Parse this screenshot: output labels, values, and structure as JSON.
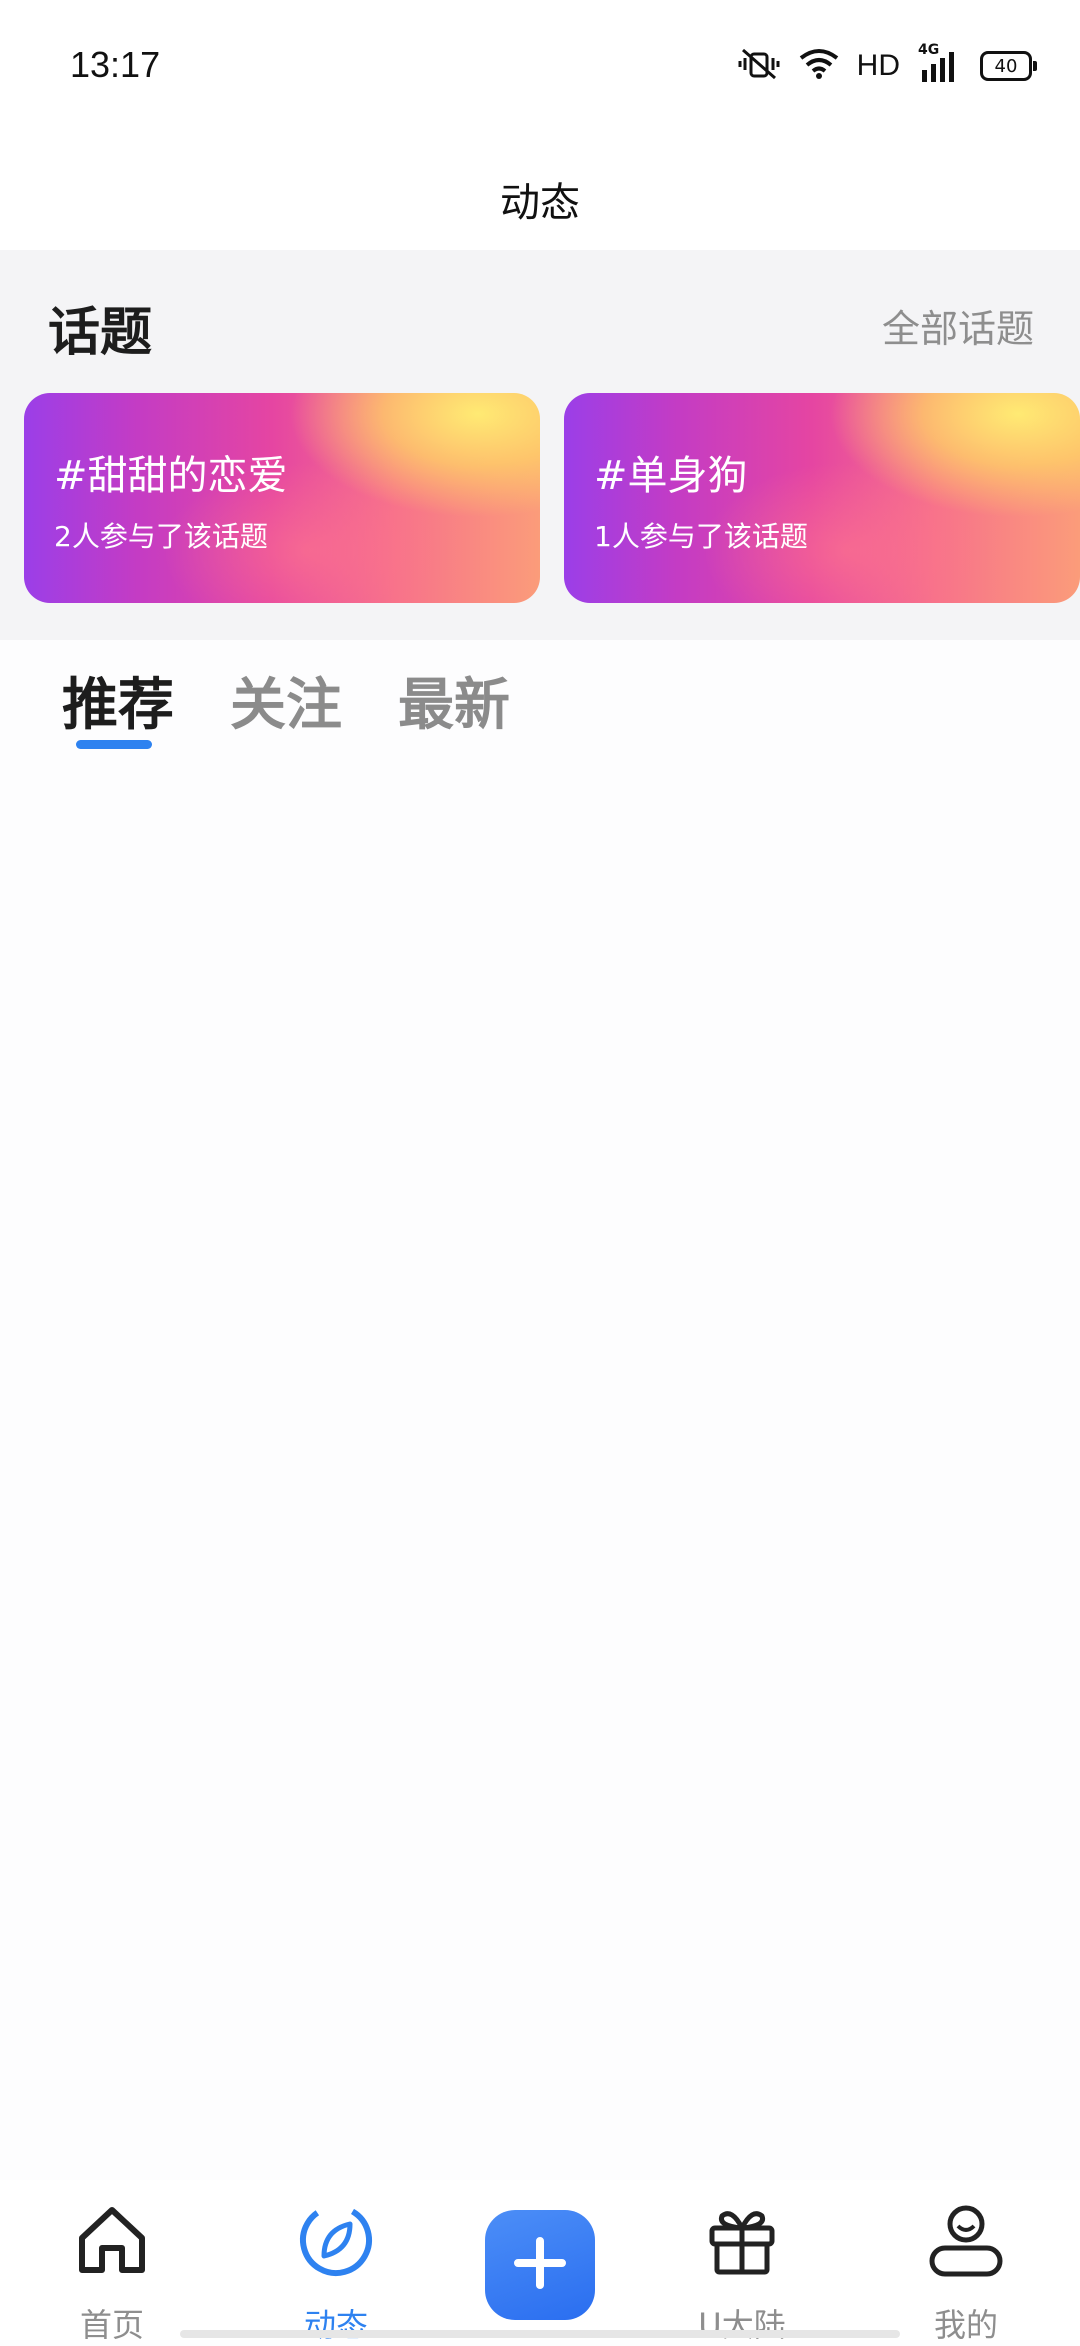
{
  "status_bar": {
    "time": "13:17",
    "network": "HD",
    "signal_label": "4G",
    "battery": "40"
  },
  "header": {
    "title": "动态"
  },
  "topics": {
    "heading": "话题",
    "all_link": "全部话题",
    "cards": [
      {
        "name": "#甜甜的恋爱",
        "participants": "2人参与了该话题"
      },
      {
        "name": "#单身狗",
        "participants": "1人参与了该话题"
      }
    ]
  },
  "tabs": [
    {
      "label": "推荐",
      "active": true
    },
    {
      "label": "关注",
      "active": false
    },
    {
      "label": "最新",
      "active": false
    }
  ],
  "bottom_nav": {
    "items": [
      {
        "label": "首页",
        "icon": "home-icon"
      },
      {
        "label": "动态",
        "icon": "compass-leaf-icon"
      },
      {
        "label": "U大陆",
        "icon": "gift-icon"
      },
      {
        "label": "我的",
        "icon": "profile-icon"
      }
    ],
    "add_icon": "plus-icon",
    "active_color": "#2e82f0"
  }
}
